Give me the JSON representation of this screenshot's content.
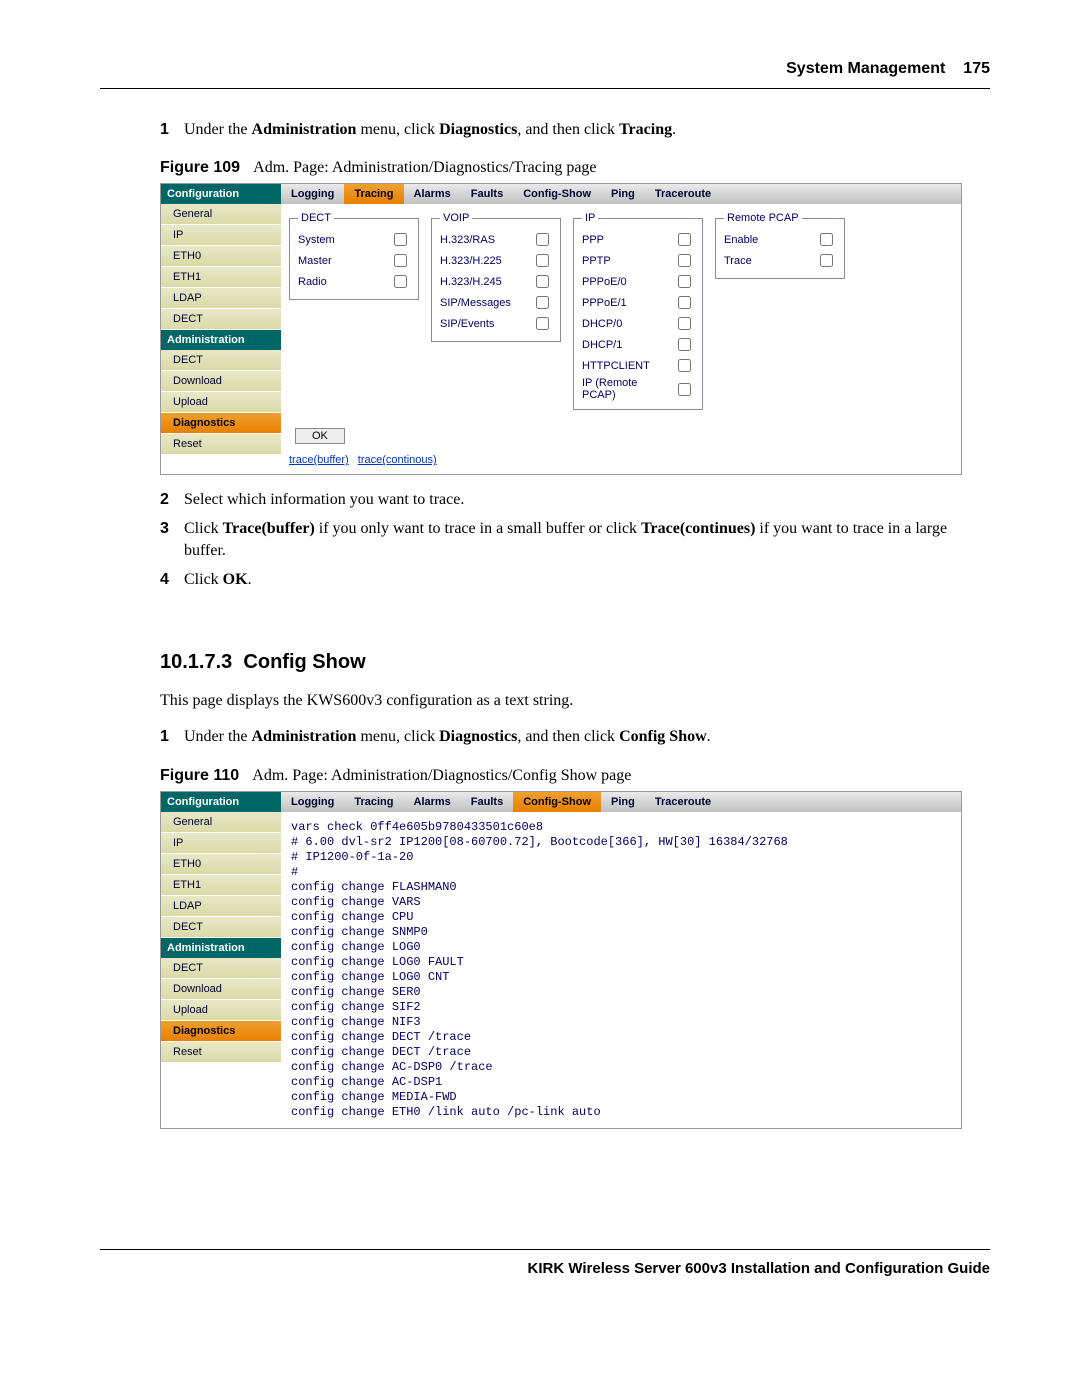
{
  "header": {
    "section": "System Management",
    "page": "175"
  },
  "steps1": [
    {
      "n": "1",
      "html": "Under the <b>Administration</b> menu, click <b>Diagnostics</b>, and then click <b>Tracing</b>."
    }
  ],
  "fig109": {
    "label": "Figure 109",
    "caption": "Adm. Page: Administration/Diagnostics/Tracing page"
  },
  "admin1": {
    "sidebar": {
      "head1": "Configuration",
      "cfg": [
        "General",
        "IP",
        "ETH0",
        "ETH1",
        "LDAP",
        "DECT"
      ],
      "head2": "Administration",
      "adm": [
        "DECT",
        "Download",
        "Upload",
        "Diagnostics",
        "Reset"
      ],
      "active": "Diagnostics"
    },
    "tabs": [
      "Logging",
      "Tracing",
      "Alarms",
      "Faults",
      "Config-Show",
      "Ping",
      "Traceroute"
    ],
    "active_tab": "Tracing",
    "dect": {
      "legend": "DECT",
      "rows": [
        "System",
        "Master",
        "Radio"
      ]
    },
    "voip": {
      "legend": "VOIP",
      "rows": [
        "H.323/RAS",
        "H.323/H.225",
        "H.323/H.245",
        "SIP/Messages",
        "SIP/Events"
      ]
    },
    "ip": {
      "legend": "IP",
      "rows": [
        "PPP",
        "PPTP",
        "PPPoE/0",
        "PPPoE/1",
        "DHCP/0",
        "DHCP/1",
        "HTTPCLIENT",
        "IP (Remote PCAP)"
      ]
    },
    "pcap": {
      "legend": "Remote PCAP",
      "rows": [
        "Enable",
        "Trace"
      ]
    },
    "ok": "OK",
    "linkA": "trace(buffer)",
    "linkB": "trace(continous)"
  },
  "steps2": [
    {
      "n": "2",
      "txt": "Select which information you want to trace."
    },
    {
      "n": "3",
      "html": "Click <b>Trace(buffer)</b> if you only want to trace in a small buffer or click <b>Trace(continues)</b> if you want to trace in a large buffer."
    },
    {
      "n": "4",
      "html": "Click <b>OK</b>."
    }
  ],
  "section": {
    "num": "10.1.7.3",
    "title": "Config Show"
  },
  "para": "This page displays the KWS600v3 configuration as a text string.",
  "steps3": [
    {
      "n": "1",
      "html": "Under the <b>Administration</b> menu, click <b>Diagnostics</b>, and then click <b>Config Show</b>."
    }
  ],
  "fig110": {
    "label": "Figure 110",
    "caption": "Adm. Page: Administration/Diagnostics/Config Show page"
  },
  "admin2": {
    "sidebar": {
      "head1": "Configuration",
      "cfg": [
        "General",
        "IP",
        "ETH0",
        "ETH1",
        "LDAP",
        "DECT"
      ],
      "head2": "Administration",
      "adm": [
        "DECT",
        "Download",
        "Upload",
        "Diagnostics",
        "Reset"
      ],
      "active": "Diagnostics"
    },
    "tabs": [
      "Logging",
      "Tracing",
      "Alarms",
      "Faults",
      "Config-Show",
      "Ping",
      "Traceroute"
    ],
    "active_tab": "Config-Show",
    "text": "vars check 0ff4e605b9780433501c60e8\n# 6.00 dvl-sr2 IP1200[08-60700.72], Bootcode[366], HW[30] 16384/32768\n# IP1200-0f-1a-20\n#\nconfig change FLASHMAN0\nconfig change VARS\nconfig change CPU\nconfig change SNMP0\nconfig change LOG0\nconfig change LOG0 FAULT\nconfig change LOG0 CNT\nconfig change SER0\nconfig change SIF2\nconfig change NIF3\nconfig change DECT /trace\nconfig change DECT /trace\nconfig change AC-DSP0 /trace\nconfig change AC-DSP1\nconfig change MEDIA-FWD\nconfig change ETH0 /link auto /pc-link auto"
  },
  "footer": "KIRK Wireless Server 600v3 Installation and Configuration Guide"
}
